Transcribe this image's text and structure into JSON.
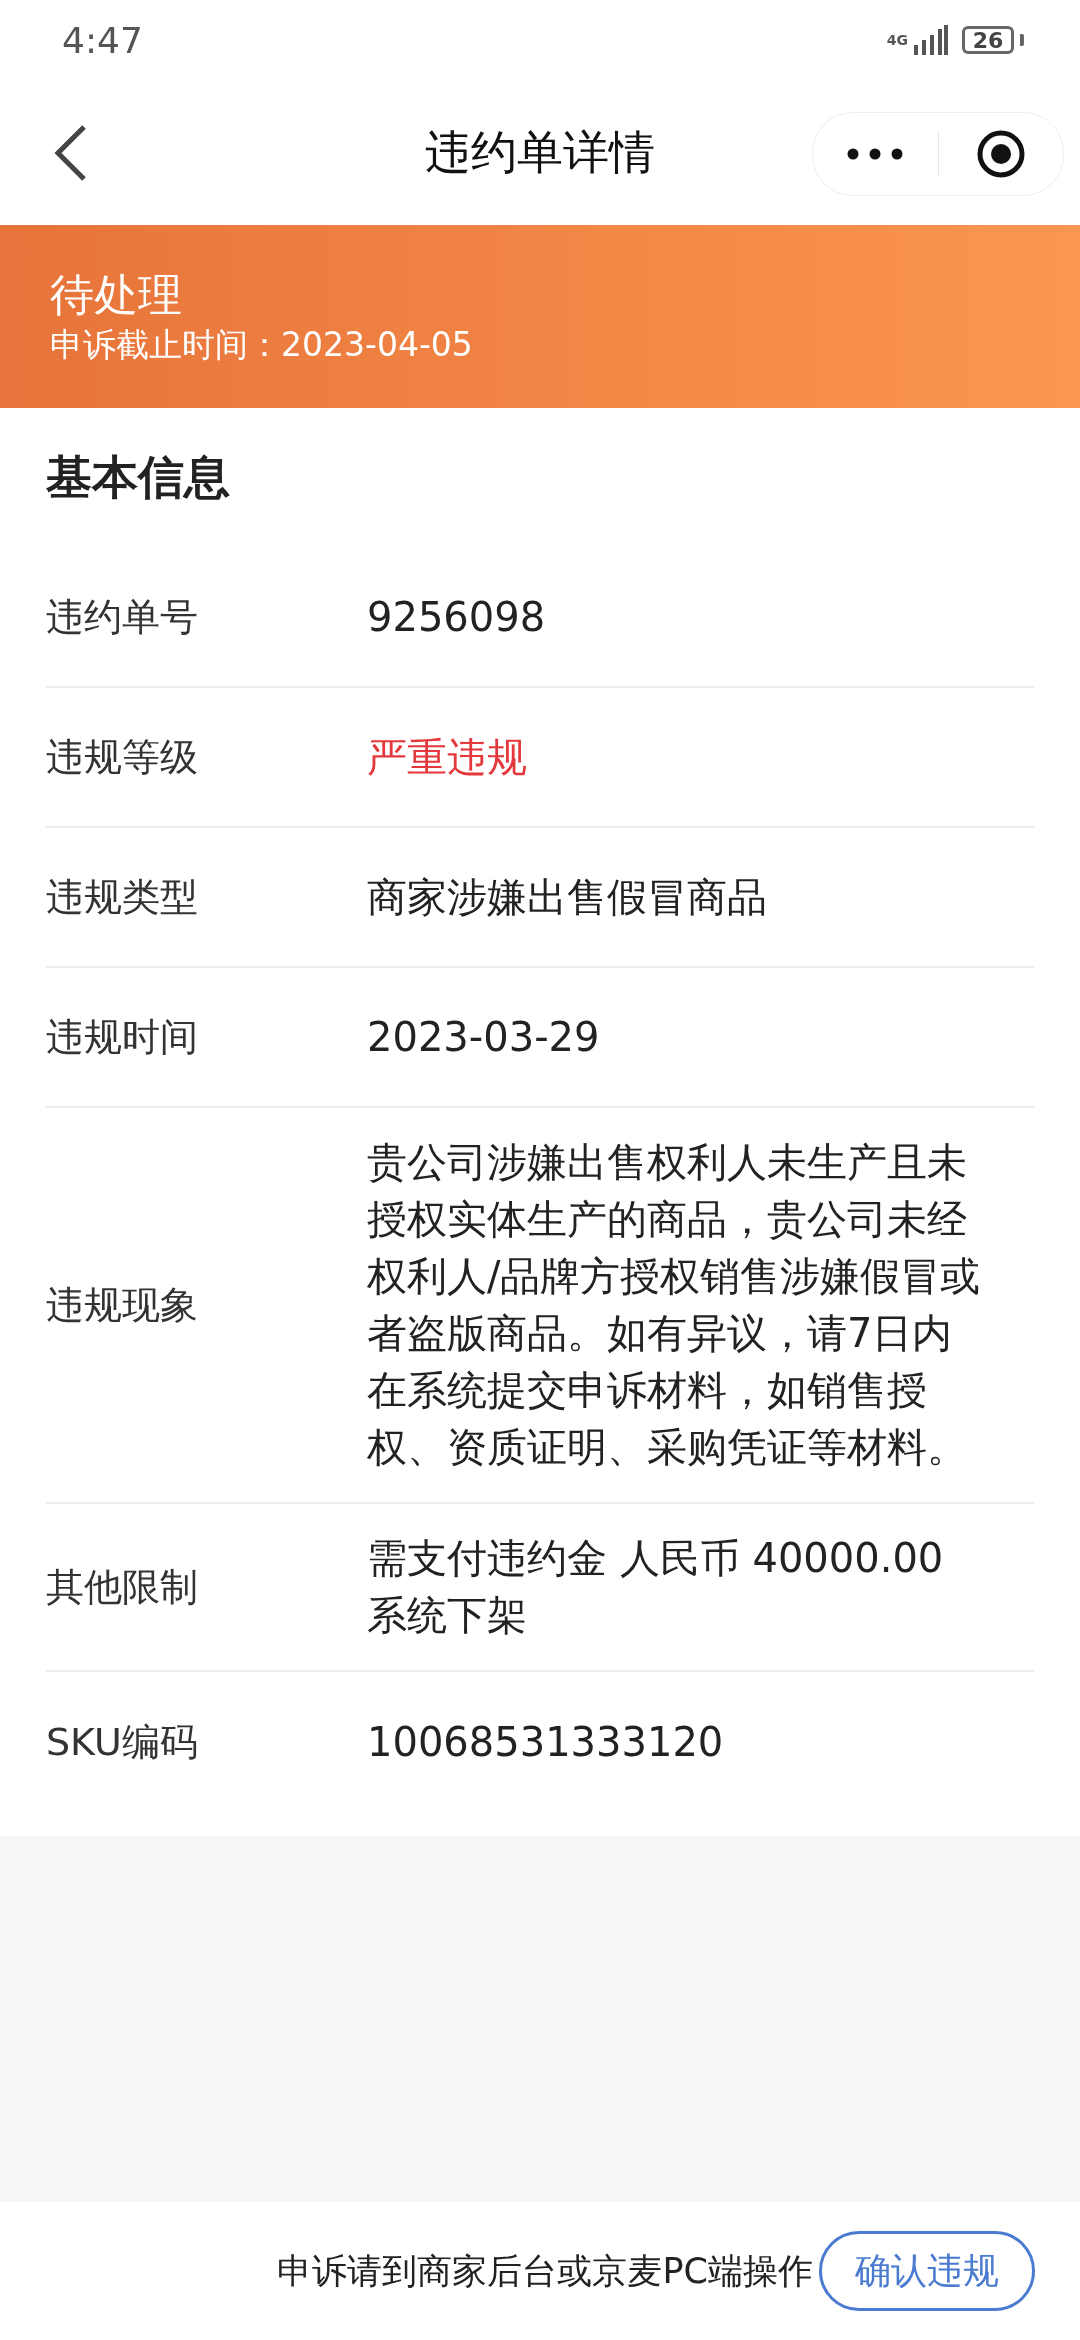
{
  "status_bar": {
    "time": "4:47",
    "network": "4G",
    "battery": "26"
  },
  "nav": {
    "title": "违约单详情"
  },
  "banner": {
    "status": "待处理",
    "deadline": "申诉截止时间：2023-04-05"
  },
  "section": {
    "title": "基本信息",
    "rows": [
      {
        "label": "违约单号",
        "kind": "plain",
        "value": [
          "9256098"
        ]
      },
      {
        "label": "违规等级",
        "kind": "alert",
        "value": [
          "严重违规"
        ]
      },
      {
        "label": "违规类型",
        "kind": "plain",
        "value": [
          "商家涉嫌出售假冒商品"
        ]
      },
      {
        "label": "违规时间",
        "kind": "plain",
        "value": [
          "2023-03-29"
        ]
      },
      {
        "label": "违规现象",
        "kind": "plain",
        "value": [
          "贵公司涉嫌出售权利人未生产且未授权实体生产的商品，贵公司未经权利人/品牌方授权销售涉嫌假冒或者盗版商品。如有异议，请7日内在系统提交申诉材料，如销售授权、资质证明、采购凭证等材料。"
        ]
      },
      {
        "label": "其他限制",
        "kind": "plain",
        "value": [
          "需支付违约金 人民币 40000.00",
          "系统下架"
        ]
      },
      {
        "label": "SKU编码",
        "kind": "plain",
        "value": [
          "10068531333120"
        ]
      }
    ]
  },
  "footer": {
    "hint": "申诉请到商家后台或京麦PC端操作",
    "button": "确认违规"
  }
}
